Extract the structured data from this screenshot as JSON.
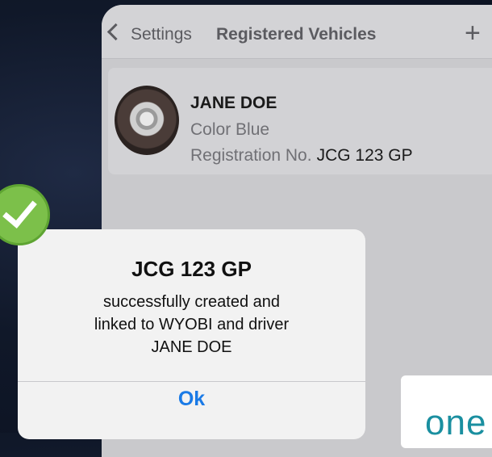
{
  "navbar": {
    "back_label": "Settings",
    "title": "Registered Vehicles",
    "add_symbol": "+"
  },
  "vehicle": {
    "owner_name": "JANE DOE",
    "color_line": "Color Blue",
    "registration_label": "Registration No.",
    "registration_value": "JCG 123 GP"
  },
  "dialog": {
    "title": "JCG 123 GP",
    "message_lines": [
      "successfully created and",
      "linked to WYOBI and driver",
      "JANE DOE"
    ],
    "ok_label": "Ok"
  },
  "logo": {
    "text": "one"
  },
  "icons": {
    "back": "chevron-left-icon",
    "add": "plus-icon",
    "success": "checkmark-icon"
  },
  "colors": {
    "accent_button": "#1a7ae6",
    "success_badge": "#7cc04a",
    "logo_teal": "#1a8fa0"
  }
}
